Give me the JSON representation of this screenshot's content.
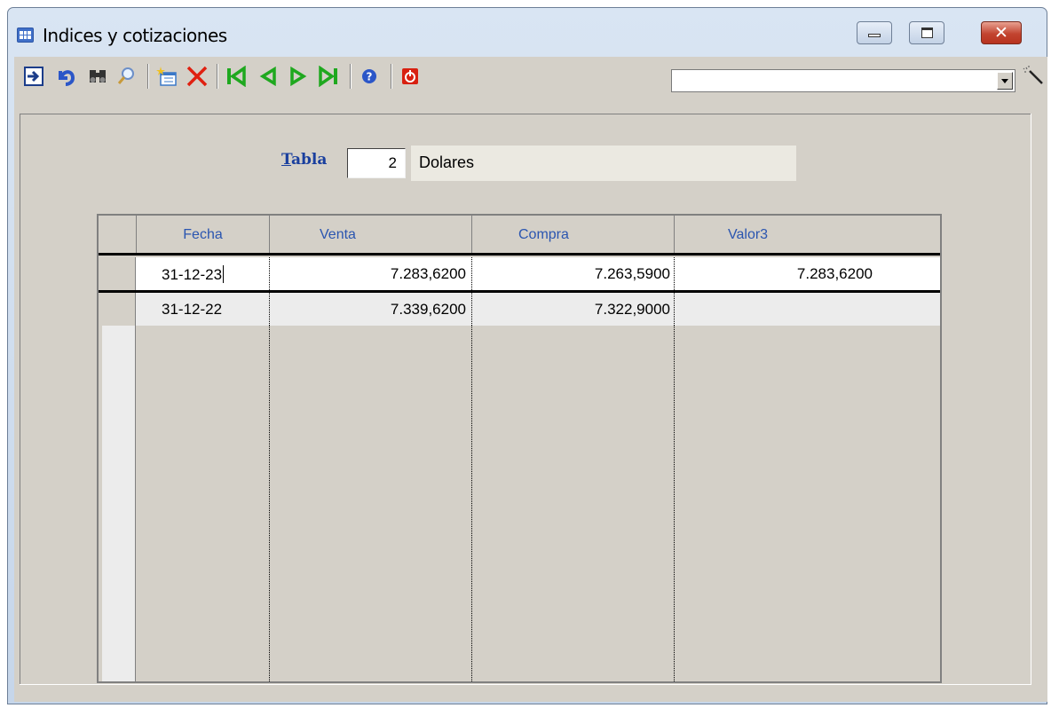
{
  "window": {
    "title": "Indices y cotizaciones",
    "close_glyph": "✕",
    "controls": [
      "minimize-icon",
      "maximize-icon",
      "close-icon"
    ]
  },
  "toolbar": {
    "icons": [
      "enter-arrow-icon",
      "undo-icon",
      "binoculars-icon",
      "magnifier-icon",
      "new-record-icon",
      "delete-icon",
      "first-record-icon",
      "previous-record-icon",
      "next-record-icon",
      "last-record-icon",
      "help-icon",
      "exit-icon"
    ],
    "combo_value": "",
    "magic_wand_icon": "magic-wand-icon"
  },
  "form": {
    "tabla_label_first": "T",
    "tabla_label_rest": "abla",
    "tabla_value": "2",
    "tabla_description": "Dolares"
  },
  "grid": {
    "columns": [
      "Fecha",
      "Venta",
      "Compra",
      "Valor3"
    ],
    "rows": [
      {
        "fecha": "31-12-23",
        "venta": "7.283,6200",
        "compra": "7.263,5900",
        "valor3": "7.283,6200"
      },
      {
        "fecha": "31-12-22",
        "venta": "7.339,6200",
        "compra": "7.322,9000",
        "valor3": ""
      }
    ]
  },
  "colors": {
    "accent_blue": "#2a55b0",
    "label_blue": "#1a3f9e",
    "nav_green": "#1fa81f",
    "delete_red": "#e02010",
    "form_bg": "#d4d0c8"
  }
}
